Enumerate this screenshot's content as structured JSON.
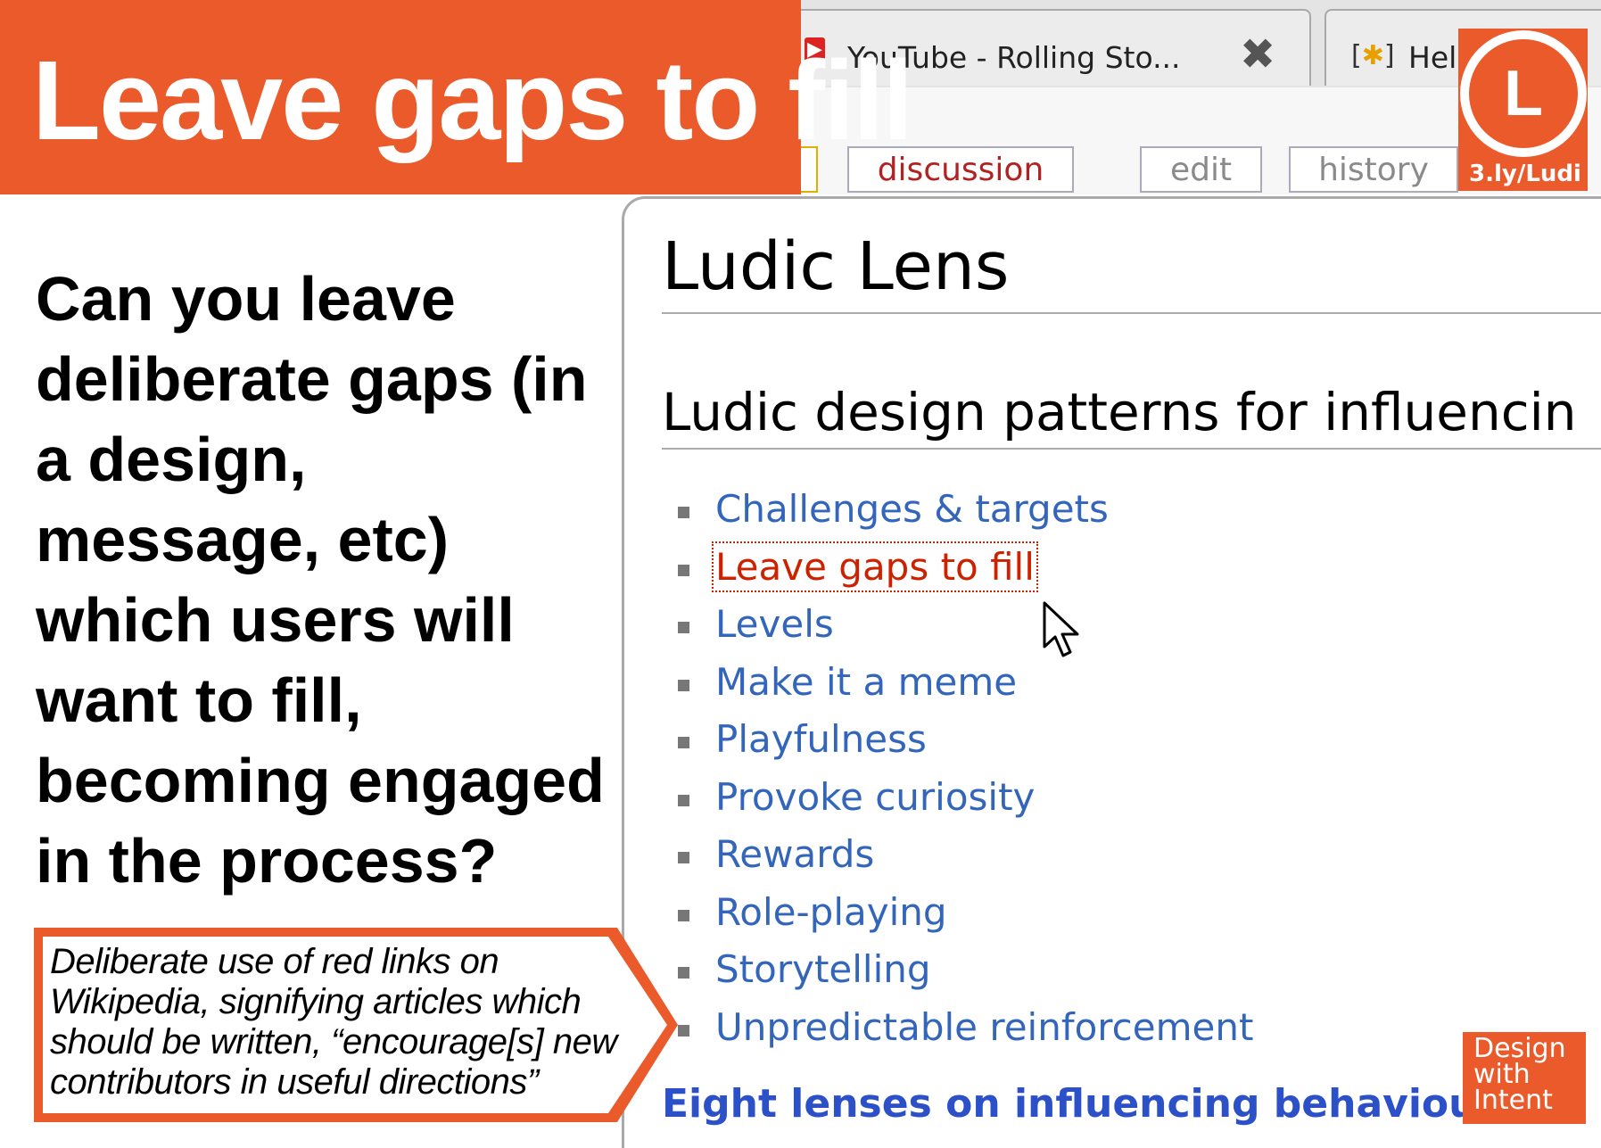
{
  "slide": {
    "title": "Leave gaps to fill",
    "question": "Can you leave deliberate gaps (in a design, message, etc) which users will want to fill, becoming engaged in the process?",
    "callout": "Deliberate use of red links on Wikipedia, signifying articles which should be written, “encourage[s] new contributors in useful directions”",
    "colors": {
      "accent": "#eb5a2a",
      "link": "#3366bb",
      "red_link": "#cc2200"
    }
  },
  "browser": {
    "tabs": [
      {
        "favicon": "youtube-icon",
        "label": "YouTube - Rolling Sto..."
      },
      {
        "favicon": "help-icon",
        "label": "Help"
      }
    ],
    "wiki_tabs": [
      "discussion",
      "edit",
      "history"
    ]
  },
  "page": {
    "title": "Ludic Lens",
    "section_heading": "Ludic design patterns for influencin",
    "patterns": [
      "Challenges & targets",
      "Leave gaps to fill",
      "Levels",
      "Make it a meme",
      "Playfulness",
      "Provoke curiosity",
      "Rewards",
      "Role-playing",
      "Storytelling",
      "Unpredictable reinforcement"
    ],
    "footer_link": "Eight lenses on influencing behaviour t"
  },
  "logo": {
    "letter": "L",
    "url": "3.ly/Ludi"
  },
  "brand": {
    "line1": "Design",
    "line2": "with",
    "line3": "Intent"
  }
}
